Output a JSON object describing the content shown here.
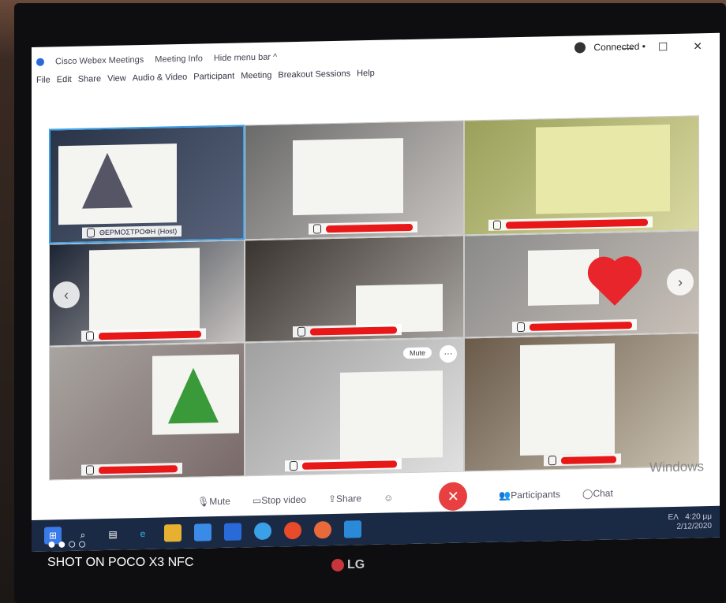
{
  "app": {
    "title": "Cisco Webex Meetings",
    "meeting_info": "Meeting Info",
    "hide_menu": "Hide menu bar ^",
    "status": "Connected •",
    "window_controls": "— ☐ ✕"
  },
  "menu": [
    "File",
    "Edit",
    "Share",
    "View",
    "Audio & Video",
    "Participant",
    "Meeting",
    "Breakout Sessions",
    "Help"
  ],
  "tiles": [
    {
      "name": "ΘΕΡΜΟΣΤΡΟΦΗ (Host)",
      "redacted": false
    },
    {
      "name": "",
      "redacted": true
    },
    {
      "name": "",
      "redacted": true
    },
    {
      "name": "",
      "redacted": true
    },
    {
      "name": "",
      "redacted": true
    },
    {
      "name": "",
      "redacted": true
    },
    {
      "name": "",
      "redacted": true
    },
    {
      "name": "",
      "redacted": true
    },
    {
      "name": "",
      "redacted": true
    }
  ],
  "tile_mute_label": "Mute",
  "nav": {
    "prev": "‹",
    "next": "›"
  },
  "controls": {
    "mute": "Mute",
    "stop_video": "Stop video",
    "share": "Share",
    "leave": "✕",
    "participants": "Participants",
    "chat": "Chat"
  },
  "watermark": "Windows",
  "tray": {
    "lang": "ΕΛ",
    "time": "4:20 μμ",
    "date": "2/12/2020"
  },
  "device": {
    "brand": "LG",
    "photo_credit": "SHOT ON POCO X3 NFC",
    "dots": "●●○○"
  },
  "colors": {
    "accent": "#3aa0e8",
    "leave": "#e84040",
    "redaction": "#e81818"
  }
}
